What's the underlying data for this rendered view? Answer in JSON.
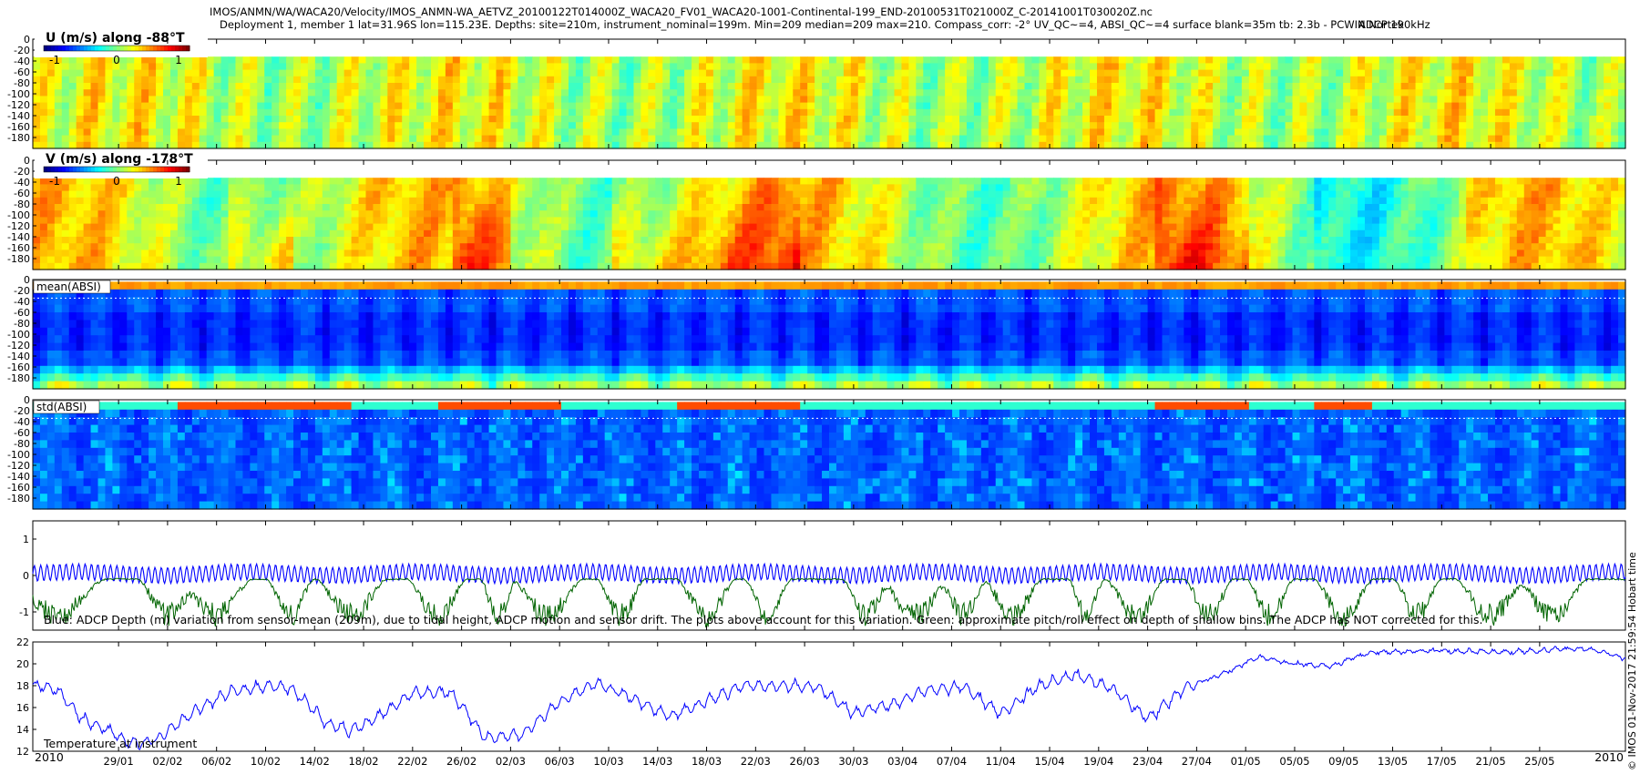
{
  "header": {
    "title_line": "IMOS/ANMN/WA/WACA20/Velocity/IMOS_ANMN-WA_AETVZ_20100122T014000Z_WACA20_FV01_WACA20-1001-Continental-199_END-20100531T021000Z_C-20141001T030020Z.nc",
    "subtitle_line": "Deployment 1, member 1 lat=31.96S lon=115.23E. Depths: site=210m, instrument_nominal=199m. Min=209 median=209 max=210. Compass_corr: -2° UV_QC~=4, ABSI_QC~=4 surface blank=35m tb: 2.3b - PCWIN Nortek",
    "instrument": "ADCP 190kHz"
  },
  "side_label": "© IMOS 01-Nov-2017 21:59:54 Hobart time",
  "time_axis": {
    "year_start": "2010",
    "year_end": "2010",
    "tick_labels": [
      "29/01",
      "02/02",
      "06/02",
      "10/02",
      "14/02",
      "18/02",
      "22/02",
      "26/02",
      "02/03",
      "06/03",
      "10/03",
      "14/03",
      "18/03",
      "22/03",
      "26/03",
      "30/03",
      "03/04",
      "07/04",
      "11/04",
      "15/04",
      "19/04",
      "23/04",
      "27/04",
      "01/05",
      "05/05",
      "09/05",
      "13/05",
      "17/05",
      "21/05",
      "25/05"
    ]
  },
  "chart_data": [
    {
      "type": "heatmap",
      "title": "U (m/s) along -88°T",
      "colorbar_ticks": [
        "-1",
        "0",
        "1"
      ],
      "y_tick_labels": [
        "0",
        "-20",
        "-40",
        "-60",
        "-80",
        "-100",
        "-120",
        "-140",
        "-160",
        "-180"
      ],
      "ylim": [
        -200,
        0
      ],
      "clim": [
        -1,
        1
      ],
      "colormap": "jet"
    },
    {
      "type": "heatmap",
      "title": "V (m/s) along -178°T",
      "colorbar_ticks": [
        "-1",
        "0",
        "1"
      ],
      "y_tick_labels": [
        "0",
        "-20",
        "-40",
        "-60",
        "-80",
        "-100",
        "-120",
        "-140",
        "-160",
        "-180"
      ],
      "ylim": [
        -200,
        0
      ],
      "clim": [
        -1,
        1
      ],
      "colormap": "jet"
    },
    {
      "type": "heatmap",
      "title": "mean(ABSI)",
      "y_tick_labels": [
        "0",
        "-20",
        "-40",
        "-60",
        "-80",
        "-100",
        "-120",
        "-140",
        "-160",
        "-180"
      ],
      "ylim": [
        -200,
        0
      ],
      "colormap": "jet"
    },
    {
      "type": "heatmap",
      "title": "std(ABSI)",
      "y_tick_labels": [
        "0",
        "-20",
        "-40",
        "-60",
        "-80",
        "-100",
        "-120",
        "-140",
        "-160",
        "-180"
      ],
      "ylim": [
        -200,
        0
      ],
      "colormap": "jet"
    },
    {
      "type": "line",
      "annotation": "Blue: ADCP Depth (m) variation from sensor-mean (209m), due to tidal height, ADCP motion and sensor drift. The plots above account for this variation. Green: approximate pitch/roll effect on depth of shallow bins. The ADCP has NOT corrected for this.",
      "y_tick_labels": [
        "1",
        "0",
        "-1"
      ],
      "ylim": [
        -1.5,
        1.5
      ],
      "series": [
        {
          "color": "#0000ff",
          "kind": "tidal",
          "mean": 0.05,
          "amplitude": 0.22
        },
        {
          "color": "#006400",
          "kind": "pitch-roll",
          "baseline": -0.1,
          "min": -1.5
        }
      ]
    },
    {
      "type": "line",
      "annotation": "Temperature at instrument",
      "y_tick_labels": [
        "22",
        "20",
        "18",
        "16",
        "14",
        "12"
      ],
      "ylim": [
        12,
        22
      ],
      "series": [
        {
          "color": "#0000ff",
          "t": [
            0,
            2,
            4,
            6,
            8,
            10,
            13,
            16,
            19,
            21,
            24,
            26,
            28,
            31,
            34,
            37,
            40,
            43,
            46,
            49,
            52,
            55,
            58,
            61,
            64,
            67,
            70,
            73,
            76,
            79,
            82,
            85,
            88,
            91,
            94,
            97,
            100,
            103,
            106,
            109,
            112,
            115,
            118,
            121,
            124,
            127,
            130
          ],
          "values": [
            18.0,
            17.6,
            15.0,
            14.0,
            12.7,
            13.0,
            15.5,
            17.4,
            18.0,
            17.8,
            14.6,
            13.9,
            15.0,
            17.3,
            17.5,
            13.2,
            13.6,
            16.5,
            18.3,
            16.8,
            15.2,
            16.6,
            18.0,
            18.0,
            17.9,
            15.5,
            16.2,
            17.6,
            17.9,
            15.4,
            17.9,
            19.0,
            17.8,
            15.0,
            17.8,
            19.0,
            20.6,
            20.0,
            19.8,
            21.0,
            21.1,
            21.2,
            21.1,
            21.1,
            21.3,
            21.4,
            20.5
          ]
        }
      ]
    }
  ]
}
